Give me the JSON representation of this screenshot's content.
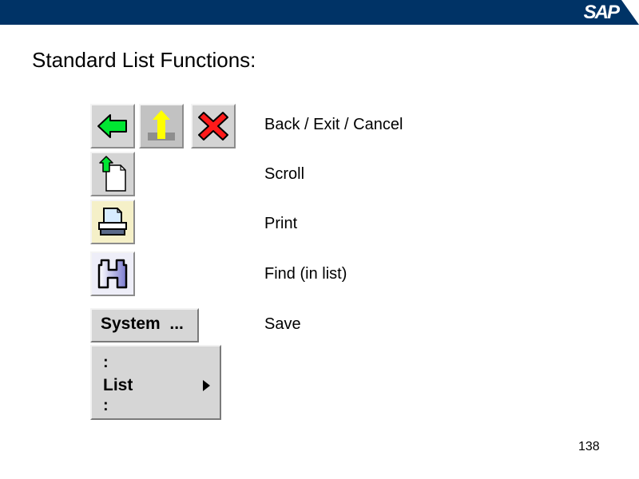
{
  "header": {
    "logo_text": "SAP",
    "bar_color": "#003366"
  },
  "slide": {
    "title": "Standard List Functions:",
    "page_number": "138"
  },
  "toolbar_buttons": [
    {
      "name": "back",
      "icon": "green-left-arrow-icon"
    },
    {
      "name": "exit",
      "icon": "yellow-up-arrow-icon"
    },
    {
      "name": "cancel",
      "icon": "red-x-icon"
    },
    {
      "name": "scroll",
      "icon": "page-up-icon"
    },
    {
      "name": "print",
      "icon": "printer-icon"
    },
    {
      "name": "find",
      "icon": "binoculars-icon"
    }
  ],
  "descriptions": [
    "Back / Exit / Cancel",
    "Scroll",
    "Print",
    "Find (in list)",
    "Save"
  ],
  "menu": {
    "header_label": "System  ...",
    "separator_top": ":",
    "item_label": "List",
    "separator_bottom": ":"
  }
}
